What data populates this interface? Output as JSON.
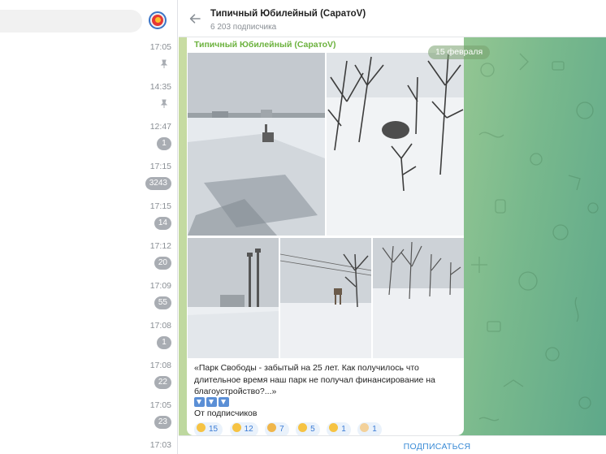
{
  "left": {
    "chats": [
      {
        "name": "",
        "preview": "",
        "time": "17:05",
        "pinned": true,
        "badge": ""
      },
      {
        "name": "",
        "preview": "",
        "time": "14:35",
        "pinned": true,
        "badge": ""
      },
      {
        "name": "",
        "preview": "",
        "time": "12:47",
        "pinned": false,
        "badge": "1"
      },
      {
        "name": "",
        "preview": "",
        "time": "17:15",
        "pinned": false,
        "badge": "3243"
      },
      {
        "name": "",
        "preview": "",
        "time": "17:15",
        "pinned": false,
        "badge": "14"
      },
      {
        "name": "",
        "preview": "",
        "time": "17:12",
        "pinned": false,
        "badge": "20"
      },
      {
        "name": "",
        "preview": "",
        "time": "17:09",
        "pinned": false,
        "badge": "55"
      },
      {
        "name": "",
        "preview": "",
        "time": "17:08",
        "pinned": false,
        "badge": "1"
      },
      {
        "name": "",
        "preview": "",
        "time": "17:08",
        "pinned": false,
        "badge": "22"
      },
      {
        "name": "",
        "preview": "",
        "time": "17:05",
        "pinned": false,
        "badge": "23"
      },
      {
        "name": "",
        "preview": "",
        "time": "17:03",
        "pinned": false,
        "badge": ""
      }
    ]
  },
  "header": {
    "title": "Типичный Юбилейный (СаратоV)",
    "subscribers": "6 203 подписчика"
  },
  "message": {
    "author": "Типичный Юбилейный (СаратоV)",
    "date": "15 февраля",
    "text": "«Парк Свободы - забытый на 25 лет. Как получилось что длительное время  наш парк  не получал финансирование на благоустройство?...»",
    "from": "От подписчиков",
    "reactions": [
      {
        "count": "15"
      },
      {
        "count": "12"
      },
      {
        "count": "7"
      },
      {
        "count": "5"
      },
      {
        "count": "1"
      },
      {
        "count": "1"
      }
    ]
  },
  "footer": {
    "subscribe": "ПОДПИСАТЬСЯ"
  },
  "colors": {
    "author": "#6cb23e",
    "accent": "#3a8bd6",
    "wallpaper_start": "#c9dca3",
    "wallpaper_end": "#5ea88a"
  }
}
